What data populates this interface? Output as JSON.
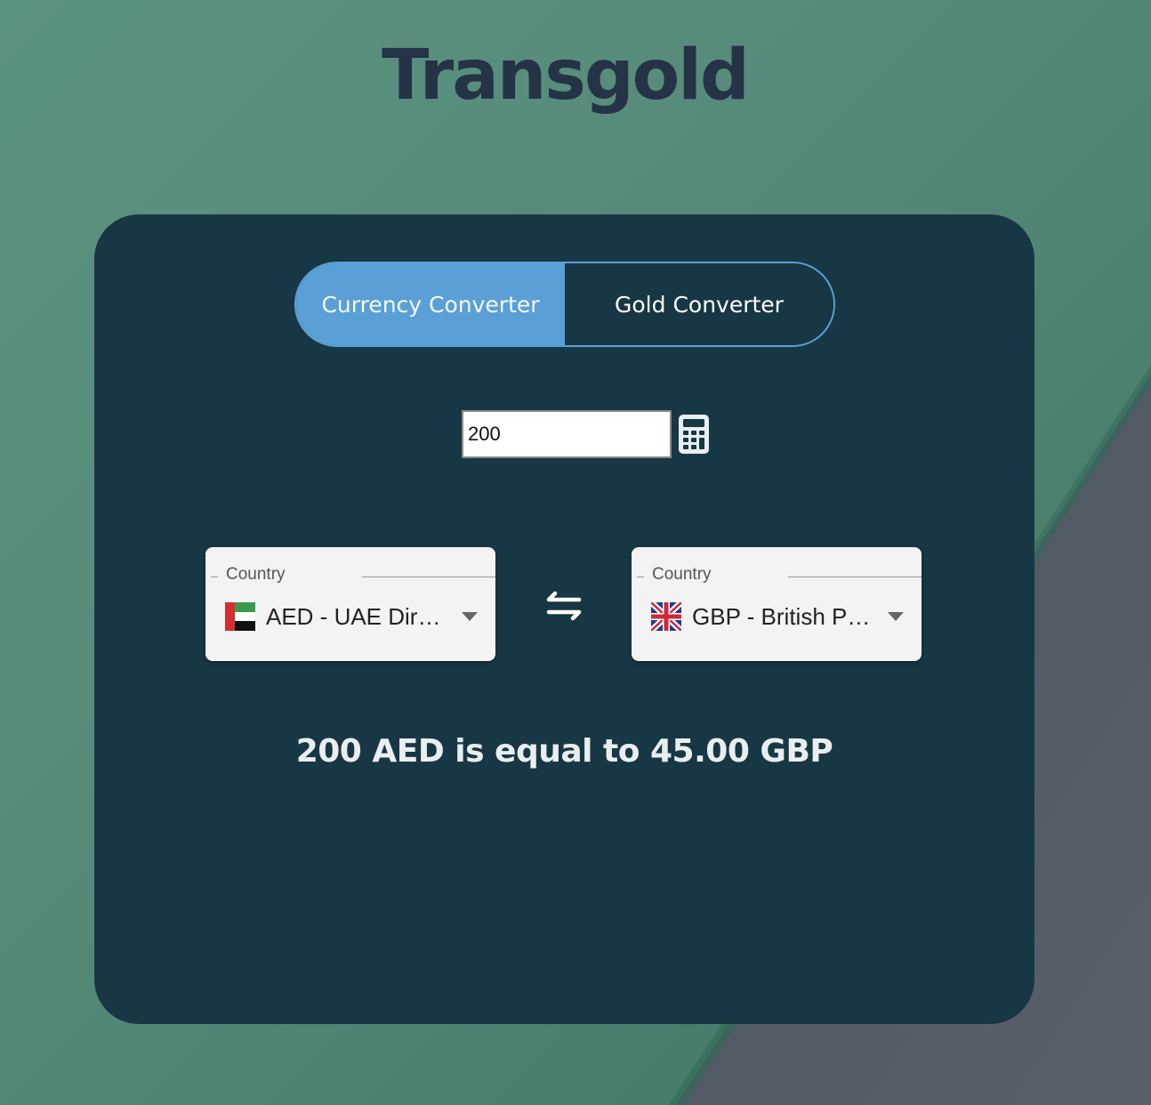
{
  "app": {
    "title": "Transgold"
  },
  "tabs": [
    {
      "label": "Currency Converter",
      "active": true
    },
    {
      "label": "Gold Converter",
      "active": false
    }
  ],
  "amount": {
    "value": "200",
    "icon": "calculator-icon"
  },
  "from_select": {
    "label": "Country",
    "value": "AED - UAE Dirham",
    "display": "AED - UAE Dir…",
    "flag": "uae-flag-icon"
  },
  "to_select": {
    "label": "Country",
    "value": "GBP - British Pound",
    "display": "GBP - British P…",
    "flag": "uk-flag-icon"
  },
  "swap": {
    "icon": "swap-arrows-icon"
  },
  "result": {
    "text": "200 AED is equal to 45.00 GBP"
  },
  "colors": {
    "title": "#253347",
    "card": "#183744",
    "accent": "#5aa0d6",
    "background": "#5b9381"
  }
}
